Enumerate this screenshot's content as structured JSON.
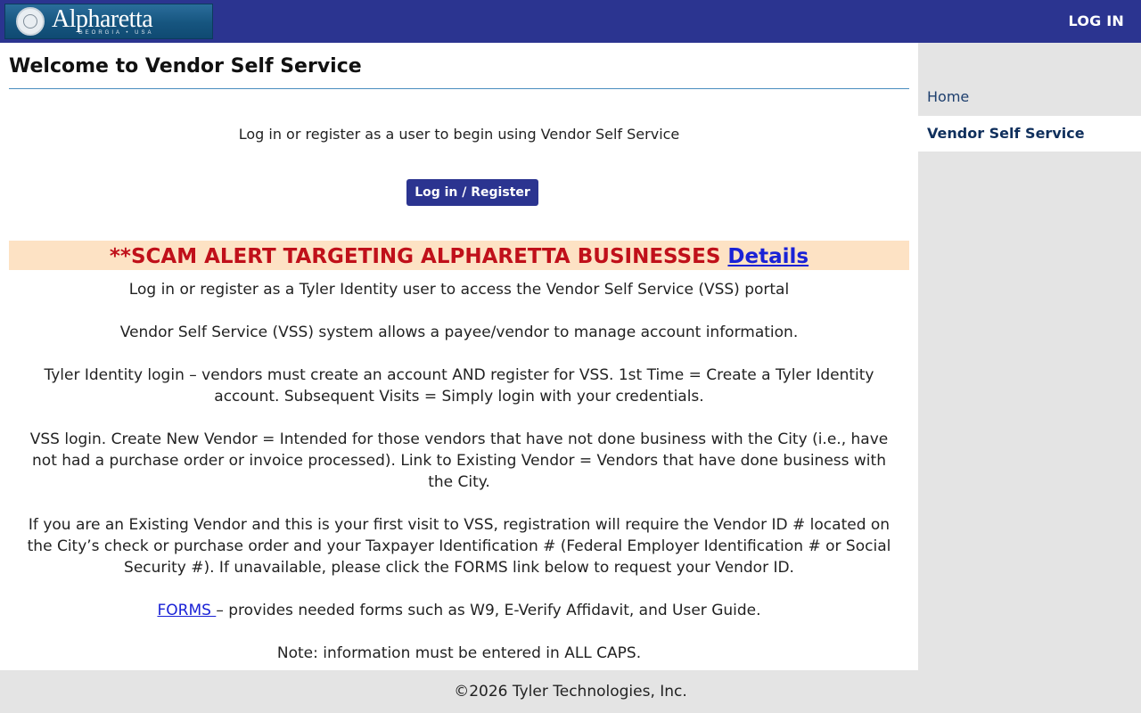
{
  "header": {
    "logo_text": "Alpharetta",
    "logo_subtext": "GEORGIA • USA",
    "login_label": "LOG IN"
  },
  "main": {
    "page_title": "Welcome to Vendor Self Service",
    "intro_text": "Log in or register as a user to begin using Vendor Self Service",
    "login_register_button": "Log in / Register",
    "scam_alert": {
      "text": "**SCAM ALERT TARGETING ALPHARETTA BUSINESSES",
      "link_label": "Details"
    },
    "paragraphs": [
      "Log in or register as a Tyler Identity user to access the Vendor Self Service (VSS) portal",
      "Vendor Self Service (VSS) system allows a payee/vendor to manage account information.",
      "Tyler Identity login – vendors must create an account AND register for VSS. 1st Time = Create a Tyler Identity account. Subsequent Visits = Simply login with your credentials.",
      "VSS login. Create New Vendor = Intended for those vendors that have not done business with the City (i.e., have not had a purchase order or invoice processed). Link to Existing Vendor = Vendors that have done business with the City.",
      "If you are an Existing Vendor and this is your first visit to VSS, registration will require the Vendor ID # located on the City’s check or purchase order and your Taxpayer Identification # (Federal Employer Identification # or Social Security #). If unavailable, please click the FORMS link below to request your Vendor ID."
    ],
    "forms_link_label": "FORMS ",
    "forms_text": "– provides needed forms such as W9, E-Verify Affidavit, and User Guide.",
    "note_text": "Note: information must be entered in ALL CAPS."
  },
  "sidebar": {
    "items": [
      {
        "label": "Home",
        "active": false
      },
      {
        "label": "Vendor Self Service",
        "active": true
      }
    ]
  },
  "footer": {
    "copyright": "©2026 Tyler Technologies, Inc."
  },
  "colors": {
    "header_bg": "#2b3490",
    "scam_bg": "#fde2c4",
    "scam_text": "#c0101a",
    "link": "#1a22d6",
    "sidebar_bg": "#e4e4e4"
  }
}
